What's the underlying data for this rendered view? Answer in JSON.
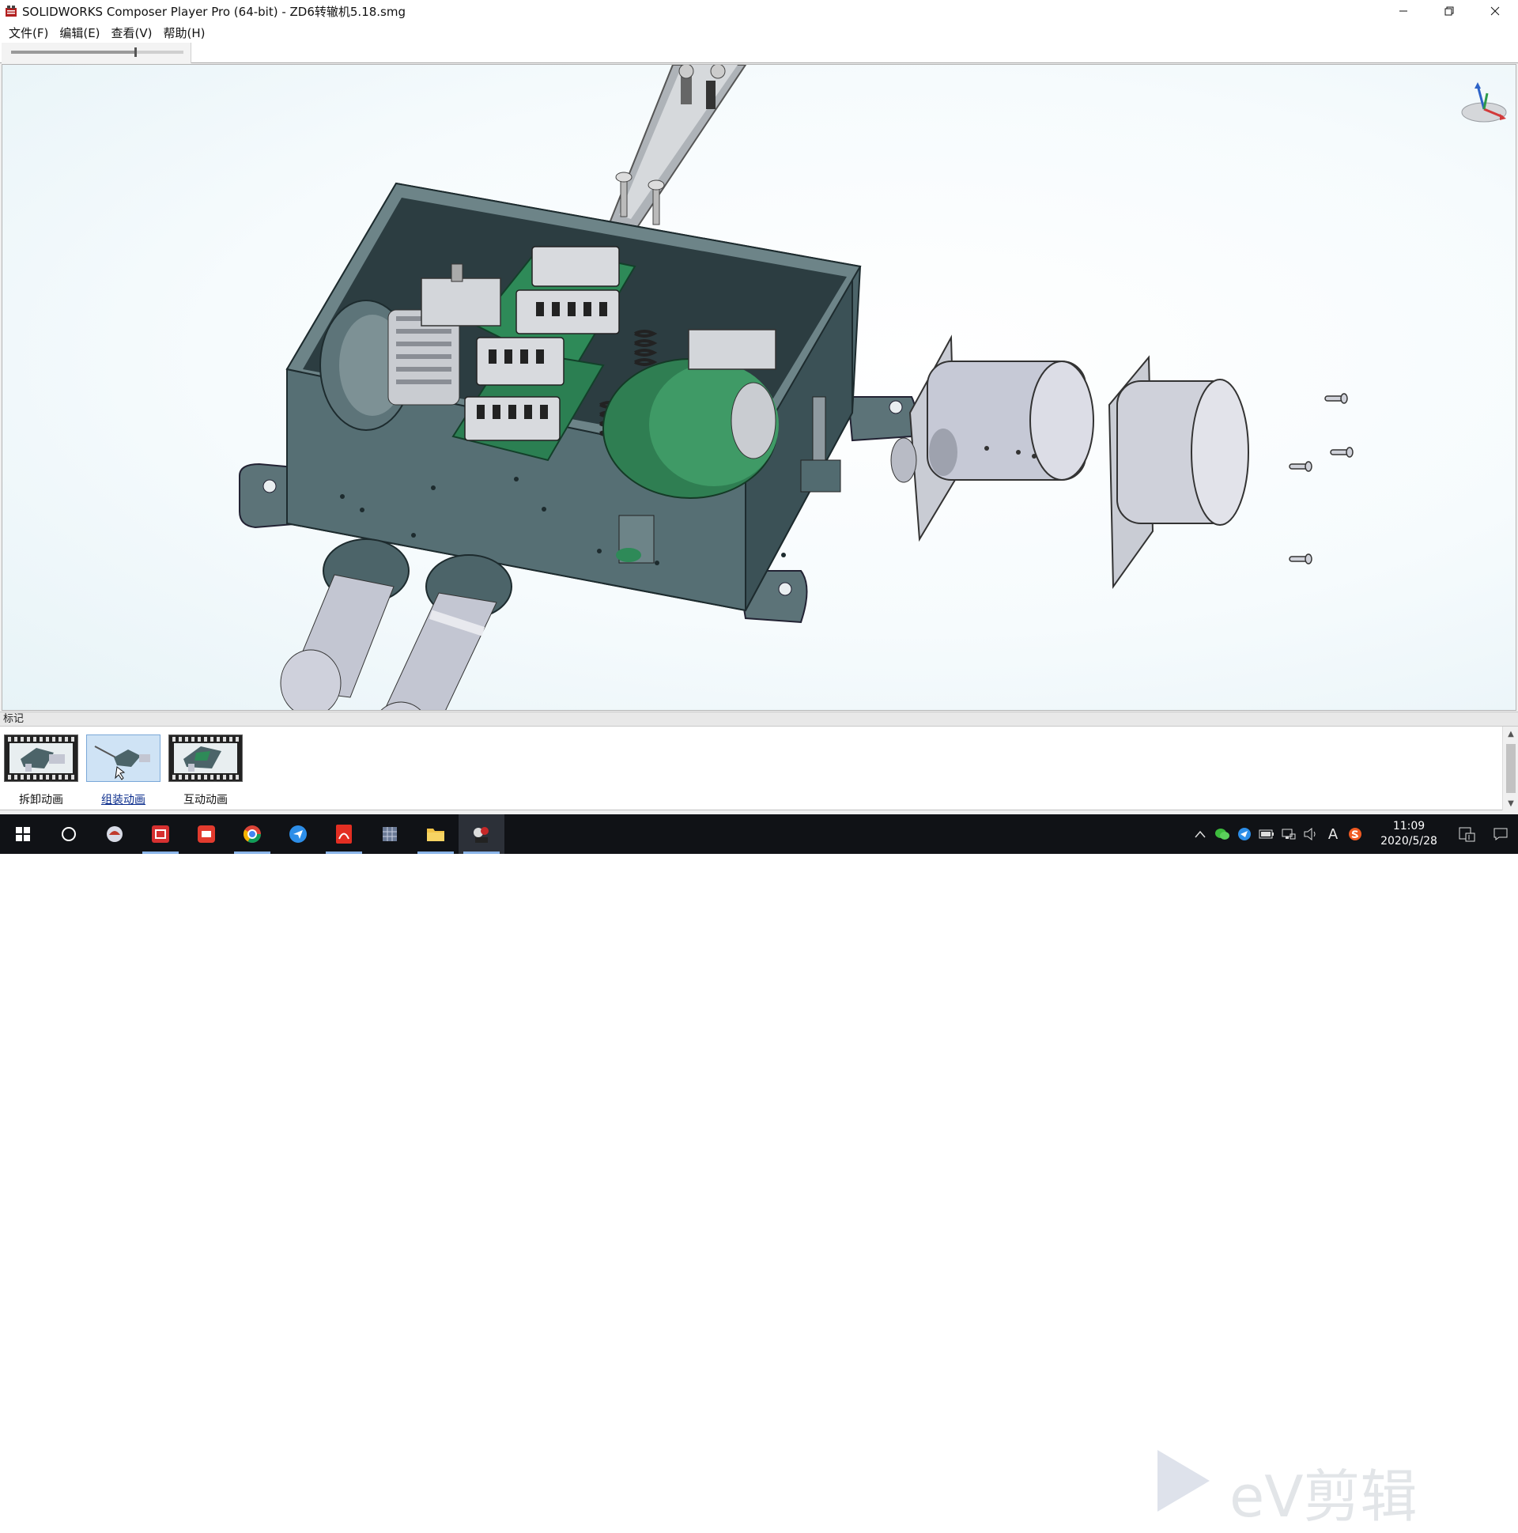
{
  "window": {
    "title": "SOLIDWORKS Composer Player Pro (64-bit) - ZD6转辙机5.18.smg",
    "controls": {
      "minimize": "minimize-icon",
      "restore": "restore-icon",
      "close": "close-icon"
    }
  },
  "menu": {
    "items": [
      {
        "label": "文件(F)"
      },
      {
        "label": "编辑(E)"
      },
      {
        "label": "查看(V)"
      },
      {
        "label": "帮助(H)"
      }
    ]
  },
  "toolbar": {
    "time_slider_progress": 0.72
  },
  "viewport": {
    "triad_icon": "axis-triad-icon",
    "background": "#f4fafc"
  },
  "markers": {
    "header": "标记",
    "items": [
      {
        "label": "拆卸动画",
        "selected": false
      },
      {
        "label": "组装动画",
        "selected": true
      },
      {
        "label": "互动动画",
        "selected": false
      }
    ]
  },
  "watermark": {
    "text": "eV剪辑"
  },
  "taskbar": {
    "apps": [
      "windows-start-icon",
      "cortana-icon",
      "app-icon",
      "app-icon",
      "youdao-icon",
      "chrome-icon",
      "feishu-icon",
      "acrobat-icon",
      "app-icon",
      "file-explorer-icon",
      "solidworks-composer-icon"
    ],
    "tray": {
      "time": "11:09",
      "date": "2020/5/28",
      "ime": "A"
    }
  },
  "colors": {
    "casing": "#3f5a60",
    "green": "#2e8a58",
    "motor": "#c8cad8",
    "accent": "#0a2c8c"
  }
}
